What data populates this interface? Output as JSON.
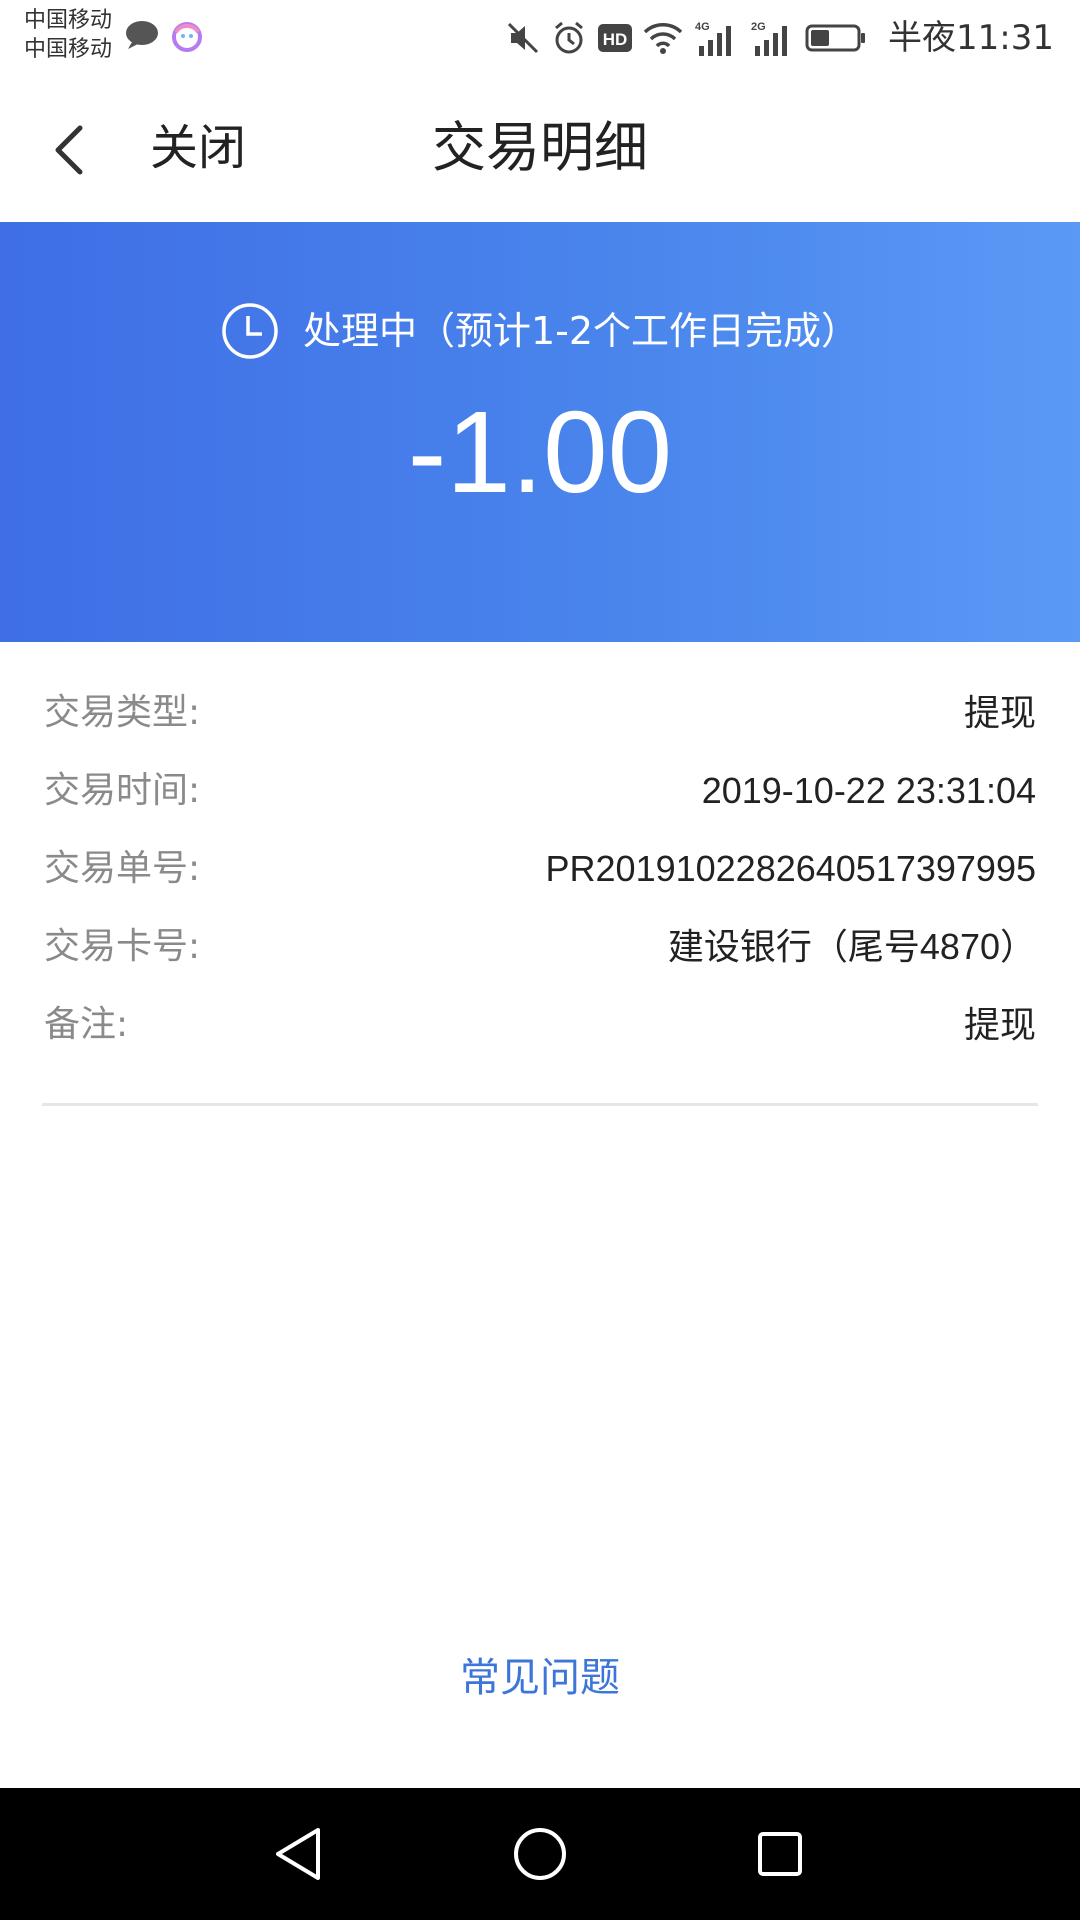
{
  "status_bar": {
    "carrier_1": "中国移动",
    "carrier_2": "中国移动",
    "time_label": "半夜11:31",
    "network_1": "4G",
    "network_2": "2G",
    "hd_badge": "HD",
    "icons": [
      "chat-icon",
      "qq-icon",
      "mute-icon",
      "alarm-icon",
      "hd-icon",
      "wifi-icon",
      "signal-4g-icon",
      "signal-2g-icon",
      "battery-icon"
    ]
  },
  "header": {
    "close_label": "关闭",
    "title": "交易明细"
  },
  "banner": {
    "status_text": "处理中（预计1-2个工作日完成）",
    "amount": "-1.00",
    "gradient_start": "#3f6ee6",
    "gradient_end": "#5b99f6"
  },
  "details": [
    {
      "label": "交易类型:",
      "value": "提现"
    },
    {
      "label": "交易时间:",
      "value": "2019-10-22 23:31:04"
    },
    {
      "label": "交易单号:",
      "value": "PR2019102282640517397995"
    },
    {
      "label": "交易卡号:",
      "value": "建设银行（尾号4870）"
    },
    {
      "label": "备注:",
      "value": "提现"
    }
  ],
  "faq_link": "常见问题",
  "colors": {
    "accent": "#3d76d9",
    "label_gray": "#8a8a8a"
  }
}
